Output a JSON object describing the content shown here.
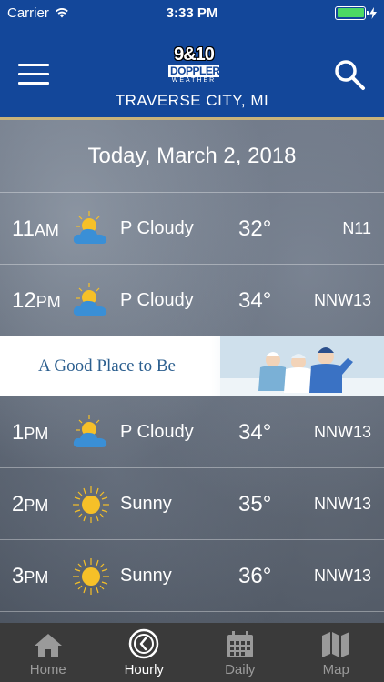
{
  "status": {
    "carrier": "Carrier",
    "time": "3:33 PM",
    "battery_level": 1.0,
    "wifi_icon": "wifi-icon",
    "charging_icon": "bolt-icon"
  },
  "header": {
    "logo": {
      "number": "9&10",
      "line1": "DOPPLER",
      "line2": "WEATHER"
    },
    "location": "TRAVERSE CITY, MI",
    "menu_icon": "hamburger-menu-icon",
    "search_icon": "search-icon"
  },
  "date": "Today, March 2, 2018",
  "hours": [
    {
      "hour": "11",
      "suffix": "AM",
      "icon": "partly-cloudy-icon",
      "condition": "P Cloudy",
      "temp": "32°",
      "wind": "N11"
    },
    {
      "hour": "12",
      "suffix": "PM",
      "icon": "partly-cloudy-icon",
      "condition": "P Cloudy",
      "temp": "34°",
      "wind": "NNW13"
    },
    {
      "hour": "1",
      "suffix": "PM",
      "icon": "partly-cloudy-icon",
      "condition": "P Cloudy",
      "temp": "34°",
      "wind": "NNW13"
    },
    {
      "hour": "2",
      "suffix": "PM",
      "icon": "sunny-icon",
      "condition": "Sunny",
      "temp": "35°",
      "wind": "NNW13"
    },
    {
      "hour": "3",
      "suffix": "PM",
      "icon": "sunny-icon",
      "condition": "Sunny",
      "temp": "36°",
      "wind": "NNW13"
    }
  ],
  "ad": {
    "text": "A Good Place to Be"
  },
  "tabs": [
    {
      "label": "Home",
      "icon": "home-icon",
      "active": false
    },
    {
      "label": "Hourly",
      "icon": "clock-icon",
      "active": true
    },
    {
      "label": "Daily",
      "icon": "calendar-icon",
      "active": false
    },
    {
      "label": "Map",
      "icon": "map-icon",
      "active": false
    }
  ],
  "colors": {
    "header_blue": "#13479a",
    "accent_gold": "#c9b37a",
    "sun_yellow": "#f6c028",
    "cloud_blue": "#3a8fd6",
    "tab_bar": "#3a3a3a",
    "tab_inactive": "#9a9a9a",
    "battery_green": "#4cd964"
  }
}
